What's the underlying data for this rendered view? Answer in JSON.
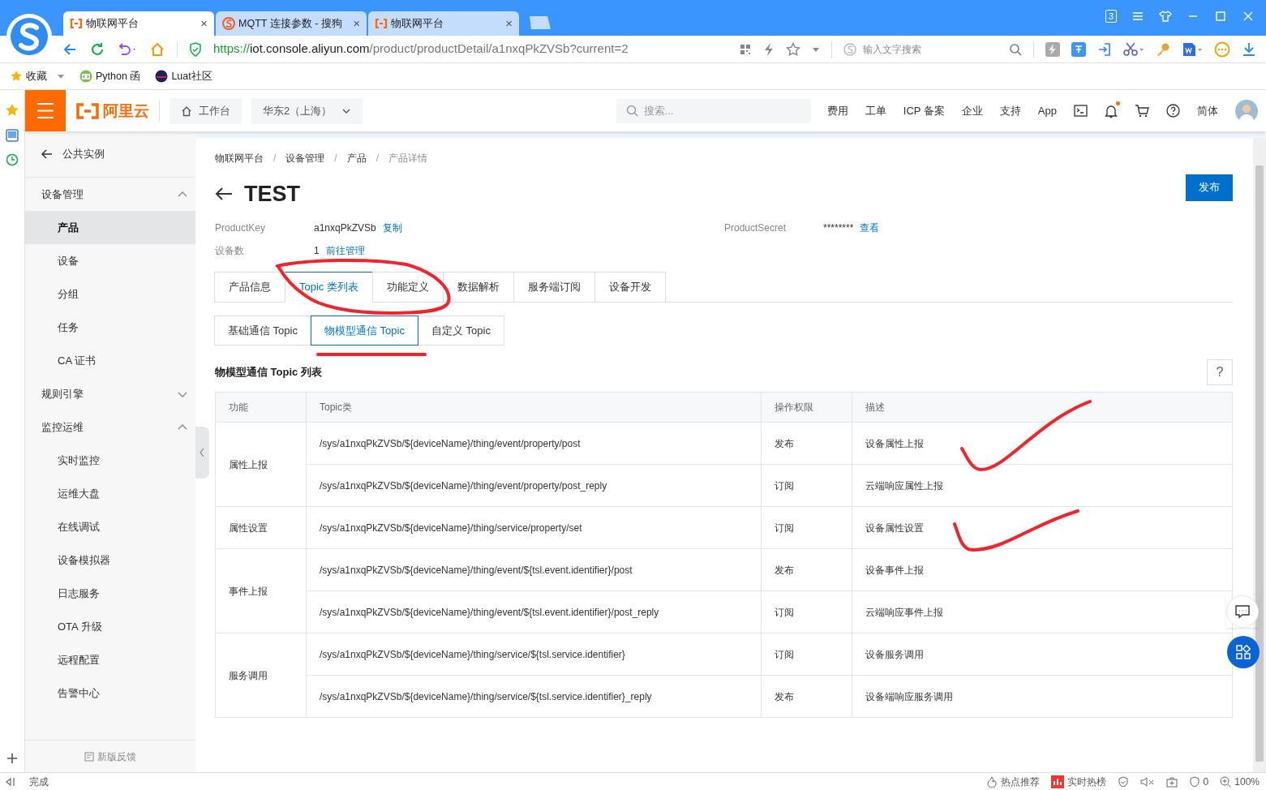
{
  "browser": {
    "tabs": [
      {
        "title": "物联网平台",
        "kind": "console",
        "selected": true,
        "close": "×"
      },
      {
        "title": "MQTT 连接参数 - 搜狗",
        "kind": "search",
        "selected": false,
        "close": "×"
      },
      {
        "title": "物联网平台",
        "kind": "console",
        "selected": false,
        "close": "×"
      }
    ],
    "tab_count": "3",
    "url": {
      "scheme": "https://",
      "host": "iot.console.aliyun.com",
      "path": "/product/productDetail/a1nxqPkZVSb?current=2"
    },
    "search_placeholder": "输入文字搜索",
    "bookmarks": [
      {
        "label": "收藏",
        "kind": "star"
      },
      {
        "label": "Python 函",
        "kind": "python"
      },
      {
        "label": "Luat社区",
        "kind": "luat"
      }
    ]
  },
  "header": {
    "logo": "阿里云",
    "workbench": "工作台",
    "region": "华东2（上海）",
    "search_placeholder": "搜索...",
    "links": [
      "费用",
      "工单",
      "ICP 备案",
      "企业",
      "支持",
      "App"
    ],
    "notification_unread": true,
    "language": "简体"
  },
  "sidebar": {
    "back": "公共实例",
    "groups": [
      {
        "label": "设备管理",
        "expanded": true,
        "items": [
          {
            "label": "产品",
            "selected": true
          },
          {
            "label": "设备",
            "selected": false
          },
          {
            "label": "分组",
            "selected": false
          },
          {
            "label": "任务",
            "selected": false
          },
          {
            "label": "CA 证书",
            "selected": false
          }
        ]
      },
      {
        "label": "规则引擎",
        "expanded": false
      },
      {
        "label": "监控运维",
        "expanded": true,
        "items": [
          {
            "label": "实时监控",
            "selected": false
          },
          {
            "label": "运维大盘",
            "selected": false
          },
          {
            "label": "在线调试",
            "selected": false
          },
          {
            "label": "设备模拟器",
            "selected": false
          },
          {
            "label": "日志服务",
            "selected": false
          },
          {
            "label": "OTA 升级",
            "selected": false
          },
          {
            "label": "远程配置",
            "selected": false
          },
          {
            "label": "告警中心",
            "selected": false
          }
        ]
      }
    ],
    "feedback": "新版反馈"
  },
  "main": {
    "breadcrumb": [
      "物联网平台",
      "设备管理",
      "产品",
      "产品详情"
    ],
    "breadcrumb_separators": [
      "/",
      "/",
      "/"
    ],
    "title": "TEST",
    "publish": "发布",
    "info": [
      {
        "label": "ProductKey",
        "value": "a1nxqPkZVSb",
        "link": "复制"
      },
      {
        "label": "ProductSecret",
        "value": "********",
        "link": "查看"
      },
      {
        "label": "设备数",
        "value": "1",
        "link": "前往管理"
      }
    ],
    "tabs": [
      {
        "label": "产品信息",
        "selected": false
      },
      {
        "label": "Topic 类列表",
        "selected": true
      },
      {
        "label": "功能定义",
        "selected": false
      },
      {
        "label": "数据解析",
        "selected": false
      },
      {
        "label": "服务端订阅",
        "selected": false
      },
      {
        "label": "设备开发",
        "selected": false
      }
    ],
    "subtabs": [
      {
        "label": "基础通信 Topic",
        "selected": false
      },
      {
        "label": "物模型通信 Topic",
        "selected": true
      },
      {
        "label": "自定义 Topic",
        "selected": false
      }
    ],
    "section_title": "物模型通信 Topic 列表",
    "help": "?",
    "table": {
      "columns": [
        "功能",
        "Topic类",
        "操作权限",
        "描述"
      ],
      "groups": [
        {
          "function": "属性上报",
          "rows": [
            {
              "topic": "/sys/a1nxqPkZVSb/${deviceName}/thing/event/property/post",
              "permission": "发布",
              "description": "设备属性上报"
            },
            {
              "topic": "/sys/a1nxqPkZVSb/${deviceName}/thing/event/property/post_reply",
              "permission": "订阅",
              "description": "云端响应属性上报"
            }
          ]
        },
        {
          "function": "属性设置",
          "rows": [
            {
              "topic": "/sys/a1nxqPkZVSb/${deviceName}/thing/service/property/set",
              "permission": "订阅",
              "description": "设备属性设置"
            }
          ]
        },
        {
          "function": "事件上报",
          "rows": [
            {
              "topic": "/sys/a1nxqPkZVSb/${deviceName}/thing/event/${tsl.event.identifier}/post",
              "permission": "发布",
              "description": "设备事件上报"
            },
            {
              "topic": "/sys/a1nxqPkZVSb/${deviceName}/thing/event/${tsl.event.identifier}/post_reply",
              "permission": "订阅",
              "description": "云端响应事件上报"
            }
          ]
        },
        {
          "function": "服务调用",
          "rows": [
            {
              "topic": "/sys/a1nxqPkZVSb/${deviceName}/thing/service/${tsl.service.identifier}",
              "permission": "订阅",
              "description": "设备服务调用"
            },
            {
              "topic": "/sys/a1nxqPkZVSb/${deviceName}/thing/service/${tsl.service.identifier}_reply",
              "permission": "发布",
              "description": "设备端响应服务调用"
            }
          ]
        }
      ]
    }
  },
  "status_bar": {
    "status": "完成",
    "hot": "热点推荐",
    "trending": "实时热榜",
    "ad_count": "0",
    "zoom": "100%"
  }
}
